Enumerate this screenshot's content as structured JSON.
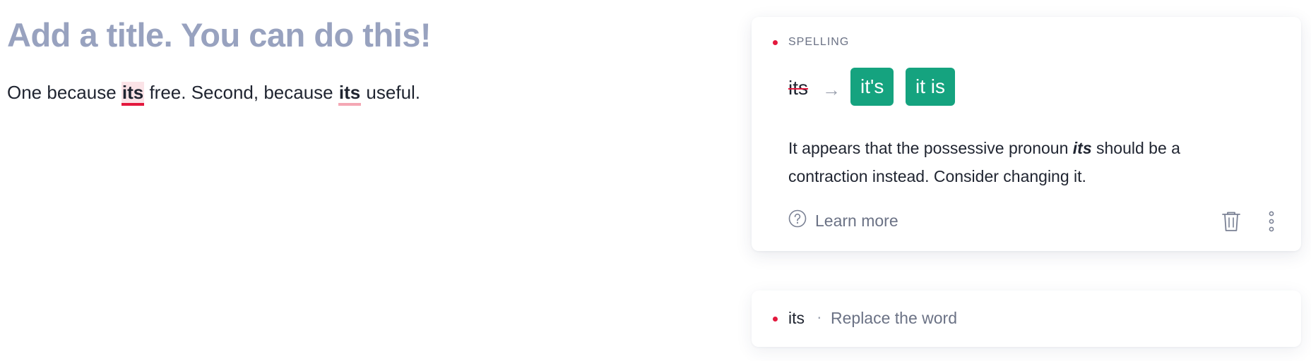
{
  "editor": {
    "title": "Add a title. You can do this!",
    "body": {
      "part1": "One because ",
      "word1": "its",
      "part2": " free. Second, because ",
      "word2": "its",
      "part3": " useful."
    }
  },
  "suggestion_card": {
    "category": "SPELLING",
    "original_word": "its",
    "arrow_icon": "arrow-right-icon",
    "suggestions": [
      "it's",
      "it is"
    ],
    "explanation": {
      "before": "It appears that the possessive pronoun ",
      "term": "its",
      "after": " should be a contraction instead. Consider changing it."
    },
    "learn_more_label": "Learn more",
    "icons": {
      "help": "question-circle-icon",
      "delete": "trash-icon",
      "more": "more-vertical-icon"
    },
    "colors": {
      "accent": "#15a37f",
      "alert": "#e3183d"
    }
  },
  "collapsed_suggestion": {
    "word": "its",
    "separator": "·",
    "description": "Replace the word"
  }
}
